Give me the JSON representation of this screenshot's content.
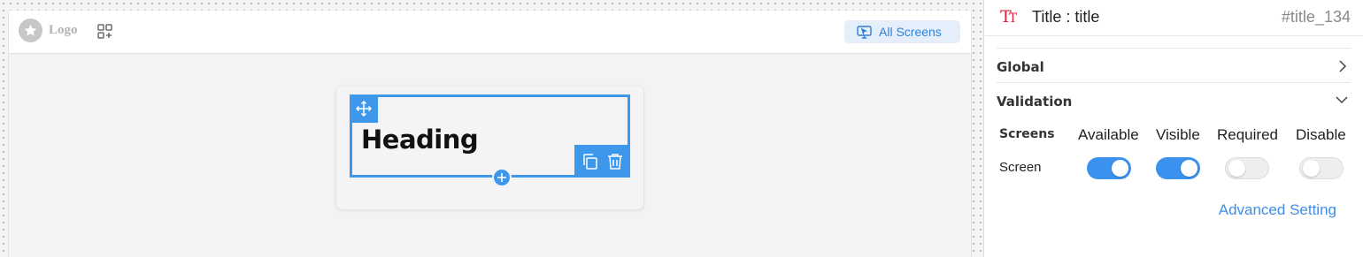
{
  "canvas": {
    "logo_text": "Logo",
    "all_screens_label": "All Screens",
    "heading_text": "Heading"
  },
  "panel": {
    "title": "Title : title",
    "element_id": "#title_134",
    "sections": {
      "global": "Global",
      "validation": "Validation"
    },
    "validation": {
      "columns": [
        "Screens",
        "Available",
        "Visible",
        "Required",
        "Disable"
      ],
      "rows": [
        {
          "label": "Screen",
          "available": true,
          "visible": true,
          "required": false,
          "disable": false
        }
      ]
    },
    "advanced_setting_label": "Advanced Setting"
  },
  "colors": {
    "accent": "#3d98ec",
    "title_icon": "#e0213f",
    "link": "#3d8ee8"
  },
  "icons": [
    "star-icon",
    "apps-add-icon",
    "monitor-cursor-icon",
    "move-icon",
    "copy-icon",
    "trash-icon",
    "plus-icon",
    "text-type-icon",
    "chevron-right-icon",
    "chevron-down-icon"
  ]
}
